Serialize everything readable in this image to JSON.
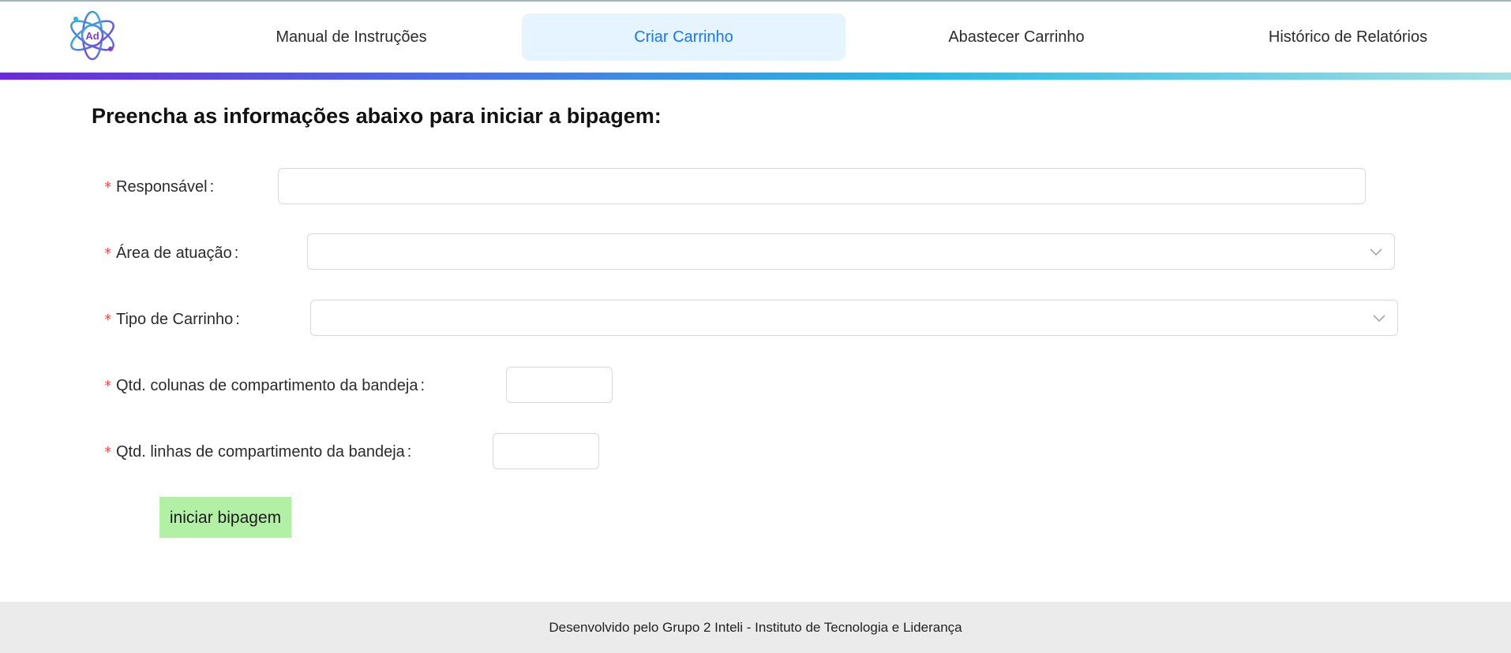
{
  "header": {
    "logo_text": "Ad",
    "nav": [
      {
        "label": "Manual de Instruções",
        "active": false
      },
      {
        "label": "Criar Carrinho",
        "active": true
      },
      {
        "label": "Abastecer Carrinho",
        "active": false
      },
      {
        "label": "Histórico de Relatórios",
        "active": false
      }
    ]
  },
  "form": {
    "title": "Preencha as informações abaixo para iniciar a bipagem:",
    "required_mark": "*",
    "fields": [
      {
        "label": "Responsável",
        "type": "text",
        "value": ""
      },
      {
        "label": "Área de atuação",
        "type": "select",
        "value": ""
      },
      {
        "label": "Tipo de Carrinho",
        "type": "select",
        "value": ""
      },
      {
        "label": "Qtd. colunas de compartimento da bandeja",
        "type": "number",
        "value": ""
      },
      {
        "label": "Qtd. linhas de compartimento da bandeja",
        "type": "number",
        "value": ""
      }
    ],
    "submit_label": "iniciar bipagem"
  },
  "footer": {
    "text": "Desenvolvido pelo Grupo 2 Inteli - Instituto de Tecnologia e Liderança"
  },
  "colors": {
    "active_tab_bg": "#e6f4ff",
    "active_tab_text": "#1677ff",
    "required": "#ff4d4f",
    "button_bg": "#b2f0a5",
    "footer_bg": "#ebebeb"
  }
}
